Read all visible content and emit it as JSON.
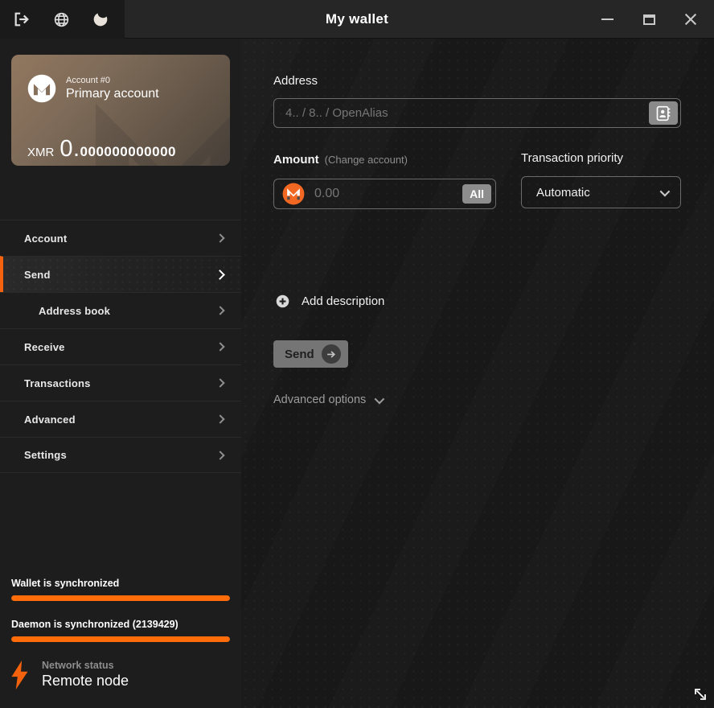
{
  "titlebar": {
    "title": "My wallet"
  },
  "sidebar": {
    "account_card": {
      "account_label": "Account #0",
      "account_name": "Primary account",
      "currency": "XMR",
      "balance_int": "0.",
      "balance_frac": "000000000000"
    },
    "menu": [
      {
        "label": "Account"
      },
      {
        "label": "Send"
      },
      {
        "label": "Address book"
      },
      {
        "label": "Receive"
      },
      {
        "label": "Transactions"
      },
      {
        "label": "Advanced"
      },
      {
        "label": "Settings"
      }
    ],
    "status": {
      "wallet_sync_text": "Wallet is synchronized",
      "wallet_sync_progress": "100",
      "daemon_sync_text": "Daemon is synchronized (2139429)",
      "daemon_sync_progress": "100",
      "network_label": "Network status",
      "network_value": "Remote node"
    }
  },
  "main": {
    "address": {
      "label": "Address",
      "placeholder": "4.. / 8.. / OpenAlias"
    },
    "amount": {
      "label": "Amount",
      "change_account": "(Change account)",
      "placeholder": "0.00",
      "all_label": "All"
    },
    "priority": {
      "label": "Transaction priority",
      "value": "Automatic"
    },
    "add_description_label": "Add description",
    "send_label": "Send",
    "advanced_options_label": "Advanced options"
  },
  "icons": {
    "titlebar": [
      "logout-icon",
      "globe-icon",
      "moon-icon"
    ],
    "window": [
      "minimize-icon",
      "maximize-icon",
      "close-icon"
    ],
    "other": [
      "address-book-icon",
      "monero-coin-icon",
      "plus-circle-icon",
      "arrow-right-icon",
      "lightning-icon",
      "resize-diagonal-icon"
    ]
  },
  "colors": {
    "accent_orange": "#ff6c09",
    "monero_orange": "#f26822",
    "selected_border": "#f4610f",
    "titlebar_bg": "#262626",
    "sidebar_bg": "#1d1d1d",
    "main_bg": "#181818",
    "card_gradient_start": "#91775f",
    "card_gradient_end": "#4e453c"
  }
}
